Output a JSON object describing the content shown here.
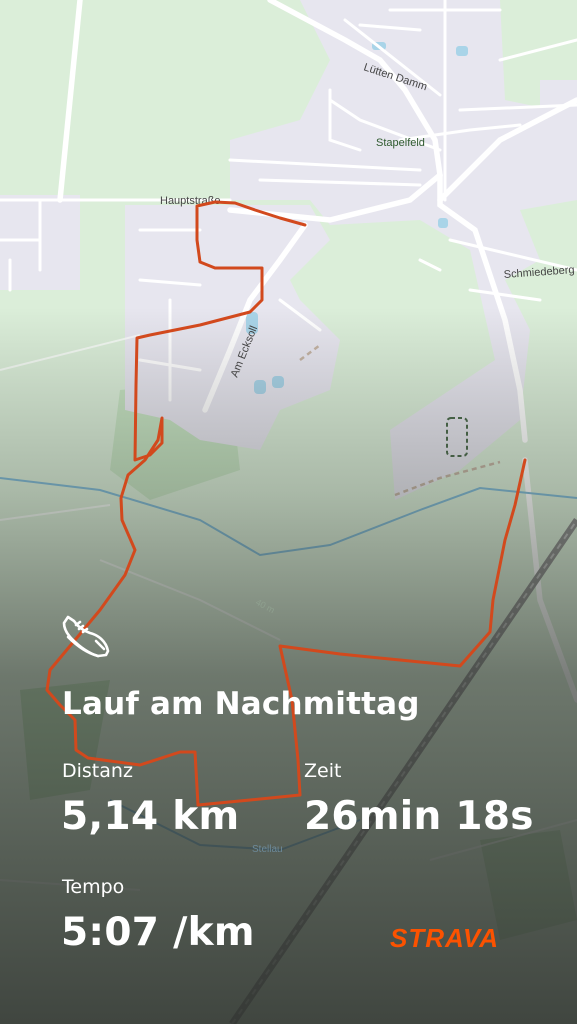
{
  "map": {
    "labels": {
      "luetten_damm": "Lütten Damm",
      "stapelfeld": "Stapelfeld",
      "hauptstrasse": "Hauptstraße",
      "schmiedeberg": "Schmiedeberg",
      "am_ecksoll": "Am Ecksoll",
      "contour": "40 m",
      "stellau": "Stellau"
    }
  },
  "activity": {
    "title": "Lauf am Nachmittag",
    "distance_label": "Distanz",
    "distance_value": "5,14 km",
    "time_label": "Zeit",
    "time_value": "26min 18s",
    "pace_label": "Tempo",
    "pace_value": "5:07 /km",
    "icon": "running-shoe-icon"
  },
  "brand": {
    "name": "STRAVA",
    "color": "#fc5200"
  },
  "colors": {
    "route": "#d2491d",
    "map_green": "#cfe7d1",
    "urban": "#e8e7ef"
  }
}
